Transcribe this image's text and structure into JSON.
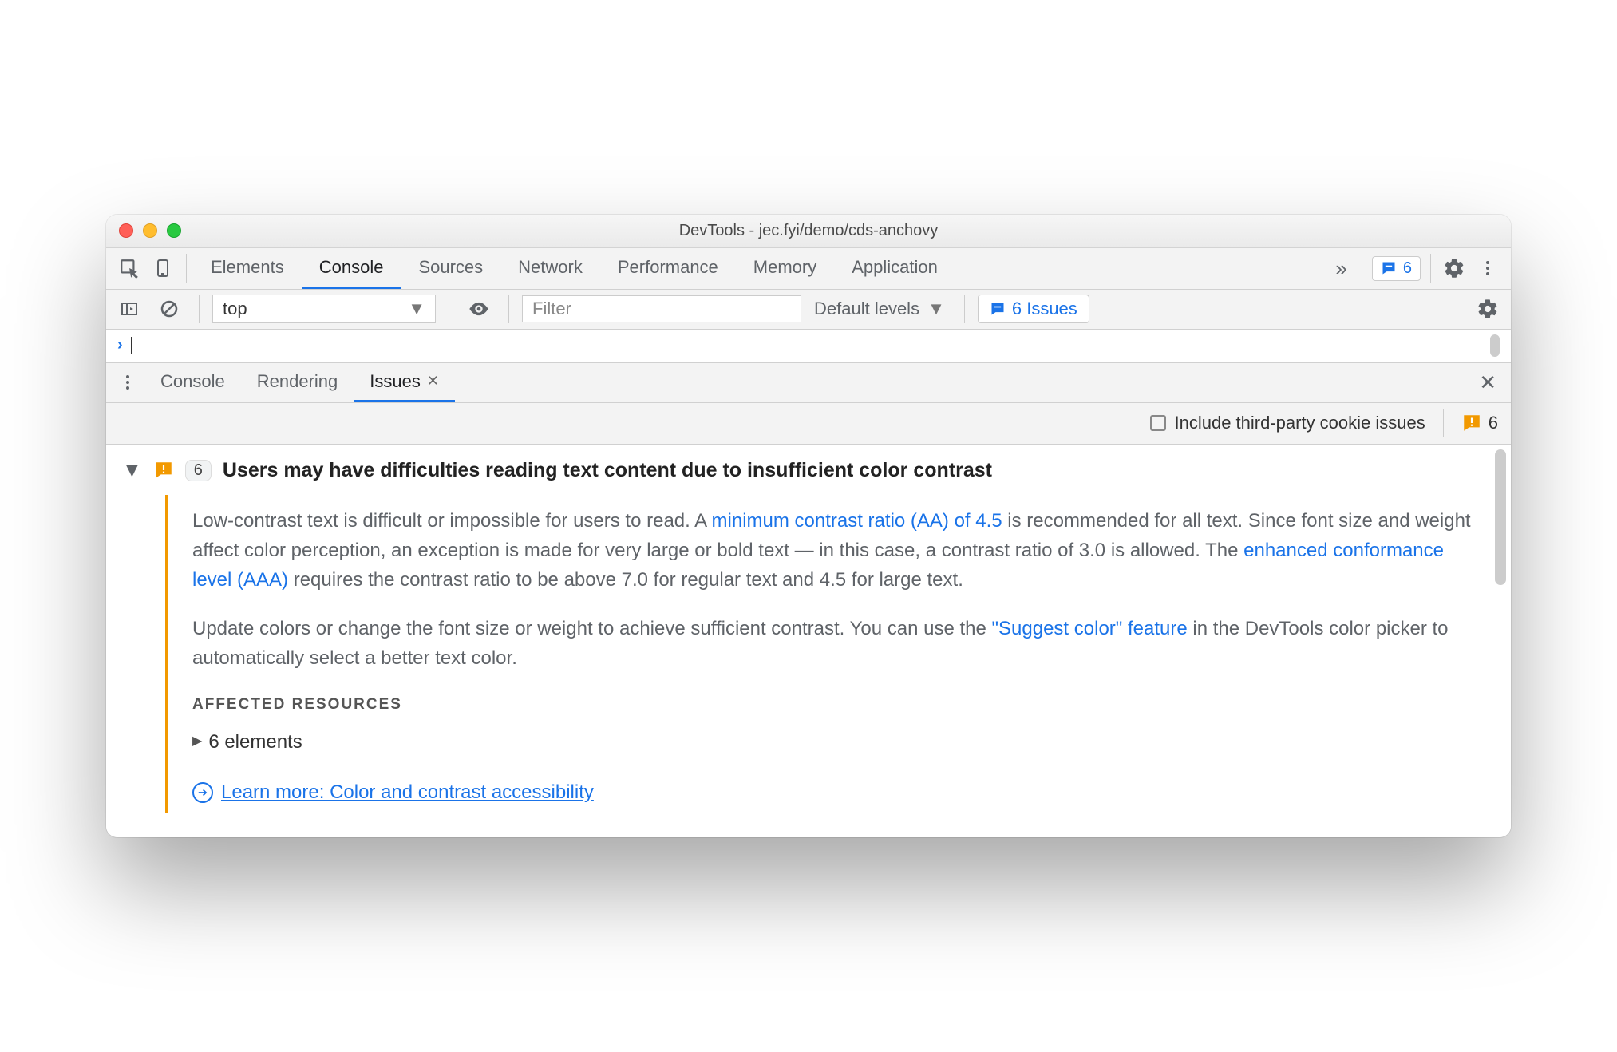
{
  "window": {
    "title": "DevTools - jec.fyi/demo/cds-anchovy"
  },
  "mainTabs": {
    "items": [
      "Elements",
      "Console",
      "Sources",
      "Network",
      "Performance",
      "Memory",
      "Application"
    ],
    "active": "Console",
    "overflow_glyph": "»",
    "badge_count": "6"
  },
  "consoleToolbar": {
    "context": "top",
    "filter_placeholder": "Filter",
    "levels": "Default levels",
    "issues_label": "6 Issues"
  },
  "drawerTabs": {
    "items": [
      "Console",
      "Rendering",
      "Issues"
    ],
    "active": "Issues"
  },
  "drawerToolbar": {
    "third_party_label": "Include third-party cookie issues",
    "warn_count": "6"
  },
  "issue": {
    "expanded": true,
    "count": "6",
    "title": "Users may have difficulties reading text content due to insufficient color contrast",
    "body": {
      "p1a": "Low-contrast text is difficult or impossible for users to read. A ",
      "p1link1": "minimum contrast ratio (AA) of 4.5",
      "p1b": " is recommended for all text. Since font size and weight affect color perception, an exception is made for very large or bold text — in this case, a contrast ratio of 3.0 is allowed. The ",
      "p1link2": "enhanced conformance level (AAA)",
      "p1c": " requires the contrast ratio to be above 7.0 for regular text and 4.5 for large text.",
      "p2a": "Update colors or change the font size or weight to achieve sufficient contrast. You can use the ",
      "p2link": "\"Suggest color\" feature",
      "p2b": " in the DevTools color picker to automatically select a better text color.",
      "affected_heading": "AFFECTED RESOURCES",
      "affected_line": "6 elements",
      "learn_more": "Learn more: Color and contrast accessibility"
    }
  }
}
